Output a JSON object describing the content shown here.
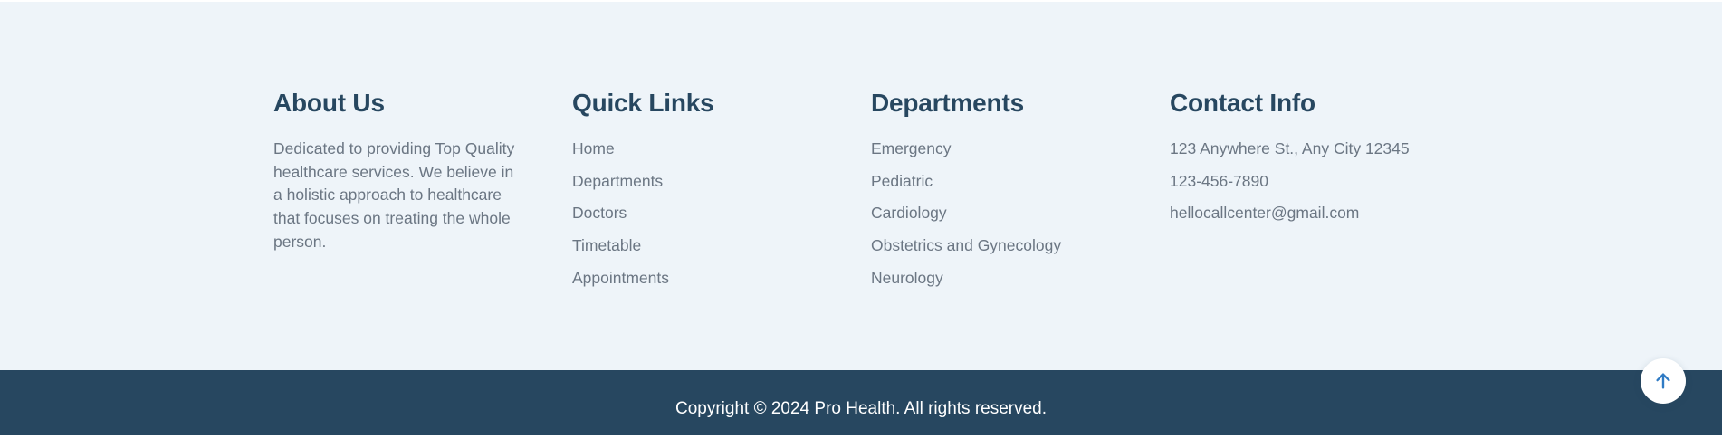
{
  "about": {
    "heading": "About Us",
    "text": "Dedicated to providing Top Quality healthcare services. We believe in a holistic approach to healthcare that focuses on treating the whole person."
  },
  "quick_links": {
    "heading": "Quick Links",
    "items": [
      "Home",
      "Departments",
      "Doctors",
      "Timetable",
      "Appointments"
    ]
  },
  "departments": {
    "heading": "Departments",
    "items": [
      "Emergency",
      "Pediatric",
      "Cardiology",
      "Obstetrics and Gynecology",
      "Neurology"
    ]
  },
  "contact": {
    "heading": "Contact Info",
    "address": "123 Anywhere St., Any City 12345",
    "phone": "123-456-7890",
    "email": "hellocallcenter@gmail.com"
  },
  "copyright": {
    "text": "Copyright © 2024 Pro Health. All rights reserved."
  },
  "scroll_top": {
    "icon": "arrow-up-icon"
  },
  "colors": {
    "heading": "#274760",
    "body_text": "#6b7683",
    "footer_bg": "#eef4f9",
    "copyright_bg": "#274760",
    "accent": "#307bc4"
  }
}
